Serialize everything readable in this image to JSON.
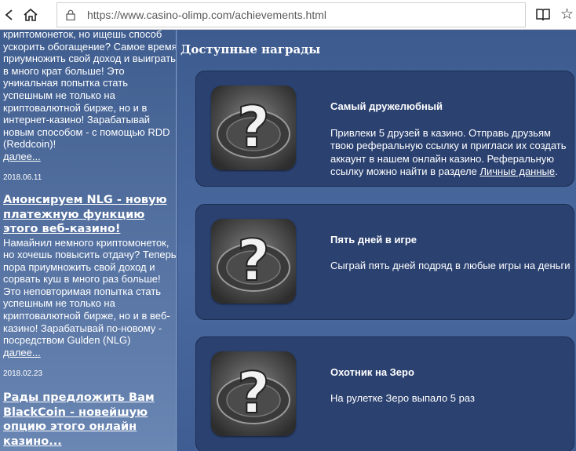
{
  "browser": {
    "url": "https://www.casino-olimp.com/achievements.html"
  },
  "sidebar": {
    "news": [
      {
        "body": "криптомонеток, но ищешь способ ускорить обогащение? Самое время приумножить свой доход и выиграть в много крат больше! Это уникальная попытка стать успешным не только на криптовалютной бирже, но и в интернет-казино! Зарабатывай новым способом - с помощью RDD (Reddcoin)!",
        "more": "далее..."
      },
      {
        "date": "2018.06.11",
        "title": "Анонсируем NLG - новую платежную функцию этого веб-казино!",
        "body": "Намайнил немного криптомонеток, но хочешь повысить отдачу? Теперь пора приумножить свой доход и сорвать куш в много раз больше! Это неповторимая попытка стать успешным не только на криптовалютной бирже, но и в веб-казино! Зарабатывай по-новому - посредством Gulden (NLG)",
        "more": "далее..."
      },
      {
        "date": "2018.02.23",
        "title": "Рады предложить Вам BlackCoin - новейшую опцию этого онлайн казино..."
      }
    ]
  },
  "main": {
    "title": "Доступные награды",
    "awards": [
      {
        "title": "Самый дружелюбный",
        "desc": "Привлеки 5 друзей в казино. Отправь друзьям твою реферальную ссылку и пригласи их создать аккаунт в нашем онлайн казино. Реферальную ссылку можно найти в разделе ",
        "link": "Личные данные",
        "suffix": ".",
        "icon": "question-chip-icon"
      },
      {
        "title": "Пять дней в игре",
        "desc": "Сыграй пять дней подряд в любые игры на деньги",
        "icon": "question-chip-icon"
      },
      {
        "title": "Охотник на Зеро",
        "desc": "На рулетке Зеро выпало 5 раз",
        "icon": "question-chip-icon"
      }
    ]
  }
}
